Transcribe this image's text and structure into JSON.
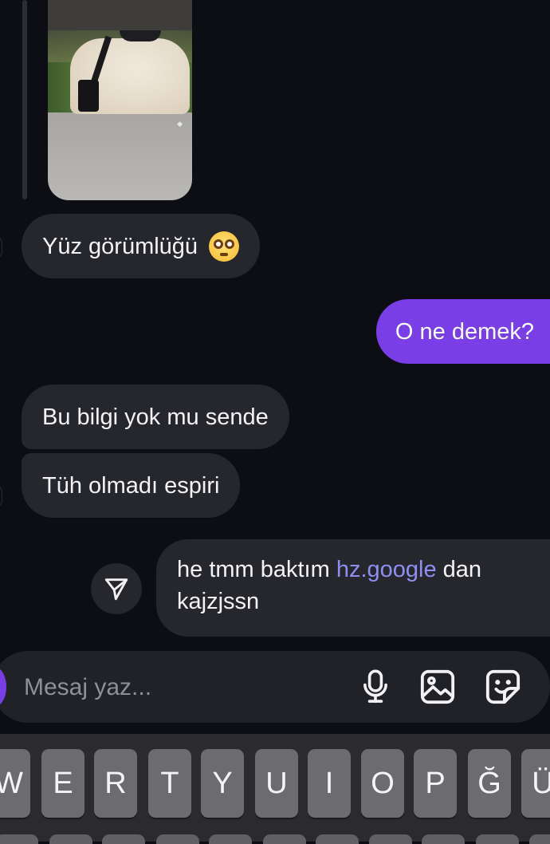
{
  "messages": {
    "received_1": "Yüz görümlüğü",
    "sent_1": "O ne demek?",
    "received_2": "Bu bilgi yok mu sende",
    "received_3": "Tüh olmadı espiri",
    "sent_2_text_before": "he tmm baktım ",
    "sent_2_link": "hz.google",
    "sent_2_text_after": " dan kajzjssn"
  },
  "composer": {
    "placeholder": "Mesaj yaz..."
  },
  "icons": {
    "send": "send-icon",
    "microphone": "microphone-icon",
    "gallery": "gallery-icon",
    "sticker": "sticker-icon"
  },
  "keyboard": {
    "keys": [
      "W",
      "E",
      "R",
      "T",
      "Y",
      "U",
      "I",
      "O",
      "P",
      "Ğ",
      "Ü"
    ]
  },
  "colors": {
    "background": "#0c0e13",
    "received_bubble": "#25272d",
    "sent_bubble": "#7a3ee6",
    "link": "#8f8ff2",
    "composer": "#202227",
    "keyboard": "#2b2b2e",
    "key": "#6b6b70"
  }
}
